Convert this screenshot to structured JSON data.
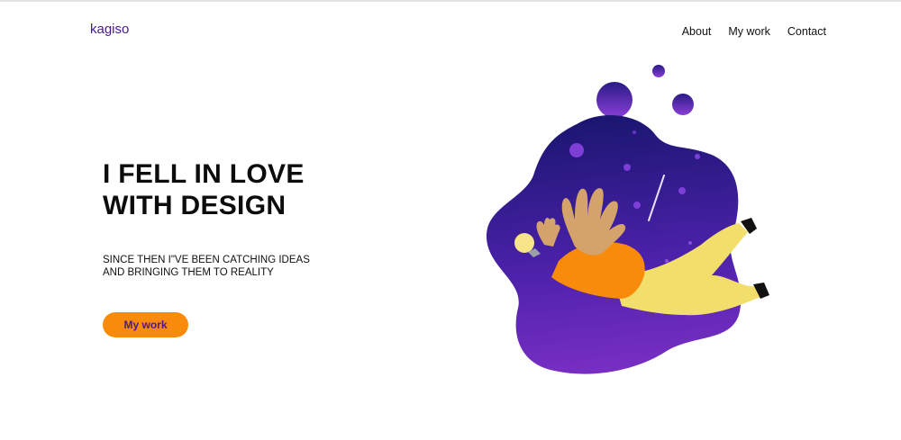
{
  "header": {
    "logo": "kagiso",
    "nav": [
      {
        "label": "About"
      },
      {
        "label": "My work"
      },
      {
        "label": "Contact"
      }
    ]
  },
  "hero": {
    "headline_lines": [
      "I FELL IN LOVE",
      "WITH DESIGN"
    ],
    "subtitle_lines": [
      "SINCE THEN I\"VE BEEN CATCHING IDEAS",
      "AND BRINGING THEM TO REALITY"
    ],
    "cta_label": "My work",
    "illustration": "person-floating-in-space-with-lightbulb"
  },
  "colors": {
    "brand": "#4b1a8c",
    "accent": "#f98b0c",
    "blob_top": "#1a1670",
    "blob_bottom": "#7a2fc4",
    "body_yellow": "#f2df6b",
    "skin": "#d4a36c"
  }
}
